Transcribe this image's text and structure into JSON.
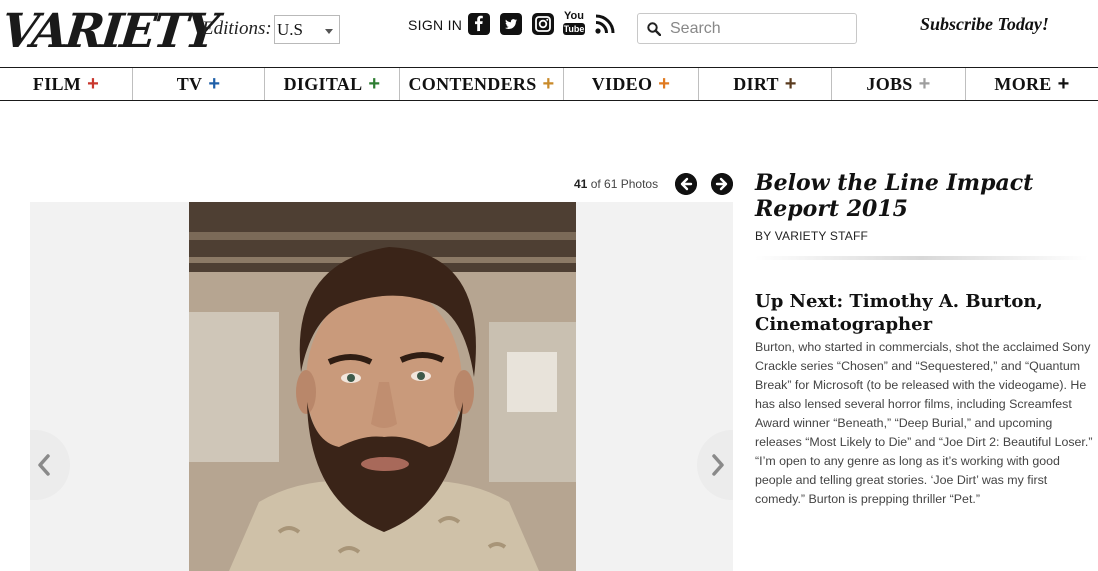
{
  "header": {
    "logo_text": "VARIETY",
    "editions_label": "Editions:",
    "edition_value": "U.S",
    "signin_label": "SIGN IN",
    "social_icons": [
      "facebook-icon",
      "twitter-icon",
      "instagram-icon",
      "youtube-icon",
      "rss-icon"
    ],
    "youtube_text_top": "You",
    "youtube_text_bottom": "Tube",
    "search_placeholder": "Search",
    "subscribe_label": "Subscribe Today!"
  },
  "nav": {
    "items": [
      {
        "label": "FILM",
        "plus_color": "#c8372d"
      },
      {
        "label": "TV",
        "plus_color": "#1f5fa8"
      },
      {
        "label": "DIGITAL",
        "plus_color": "#2e7d32"
      },
      {
        "label": "CONTENDERS",
        "plus_color": "#c98a2a"
      },
      {
        "label": "VIDEO",
        "plus_color": "#e07b22"
      },
      {
        "label": "DIRT",
        "plus_color": "#5a3b1e"
      },
      {
        "label": "JOBS",
        "plus_color": "#9e9e9e"
      },
      {
        "label": "MORE",
        "plus_color": "#111111"
      }
    ],
    "plus_symbol": "+"
  },
  "gallery": {
    "current": "41",
    "of_text": "of 61 Photos",
    "title": "Below the Line Impact Report 2015",
    "byline": "BY VARIETY STAFF",
    "up_next_heading": "Up Next: Timothy A. Burton, Cinematographer",
    "caption": "Burton, who started in commercials, shot the acclaimed Sony Crackle series “Chosen” and “Sequestered,” and “Quantum Break” for Microsoft (to be released with the videogame). He has also lensed several horror films, including Screamfest Award winner “Beneath,” “Deep Burial,” and upcoming releases “Most Likely to Die” and “Joe Dirt 2: Beautiful Loser.” “I’m open to any genre as long as it’s working with good people and telling great stories. ‘Joe Dirt’ was my first comedy.” Burton is prepping thriller “Pet.”"
  }
}
